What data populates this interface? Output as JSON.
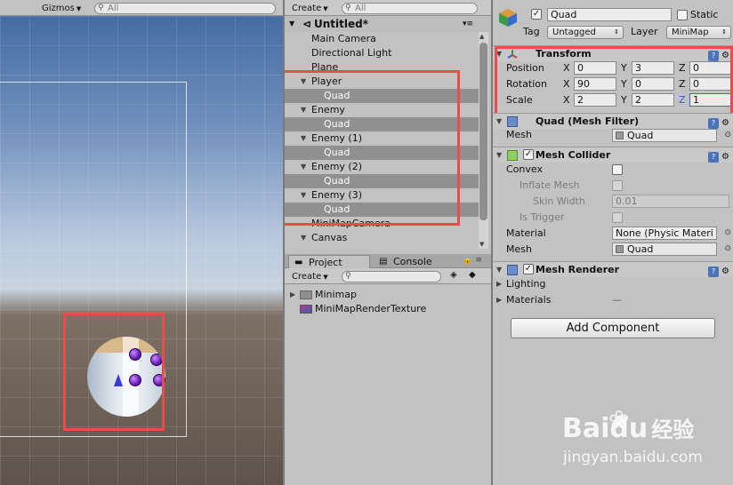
{
  "scene": {
    "gizmos_label": "Gizmos",
    "search_placeholder": "All"
  },
  "hierarchy": {
    "create_label": "Create",
    "search_placeholder": "All",
    "scene_title": "Untitled*",
    "items": [
      {
        "label": "Main Camera"
      },
      {
        "label": "Directional Light"
      },
      {
        "label": "Plane"
      },
      {
        "label": "Player"
      },
      {
        "label": "Quad"
      },
      {
        "label": "Enemy"
      },
      {
        "label": "Quad"
      },
      {
        "label": "Enemy (1)"
      },
      {
        "label": "Quad"
      },
      {
        "label": "Enemy (2)"
      },
      {
        "label": "Quad"
      },
      {
        "label": "Enemy (3)"
      },
      {
        "label": "Quad"
      },
      {
        "label": "MiniMapCamera"
      },
      {
        "label": "Canvas"
      }
    ]
  },
  "project": {
    "tab_project": "Project",
    "tab_console": "Console",
    "create_label": "Create",
    "items": [
      {
        "label": "Minimap",
        "icon": "folder-icon"
      },
      {
        "label": "MiniMapRenderTexture",
        "icon": "render-texture-icon"
      }
    ]
  },
  "inspector": {
    "object_name": "Quad",
    "static_label": "Static",
    "tag_label": "Tag",
    "tag_value": "Untagged",
    "layer_label": "Layer",
    "layer_value": "MiniMap",
    "transform": {
      "title": "Transform",
      "position_label": "Position",
      "rotation_label": "Rotation",
      "scale_label": "Scale",
      "x_label": "X",
      "y_label": "Y",
      "z_label": "Z",
      "position": {
        "x": "0",
        "y": "3",
        "z": "0"
      },
      "rotation": {
        "x": "90",
        "y": "0",
        "z": "0"
      },
      "scale": {
        "x": "2",
        "y": "2",
        "z": "1"
      }
    },
    "mesh_filter": {
      "title": "Quad (Mesh Filter)",
      "mesh_label": "Mesh",
      "mesh_value": "Quad"
    },
    "mesh_collider": {
      "title": "Mesh Collider",
      "convex_label": "Convex",
      "inflate_label": "Inflate Mesh",
      "skin_label": "Skin Width",
      "skin_value": "0.01",
      "trigger_label": "Is Trigger",
      "material_label": "Material",
      "material_value": "None (Physic Materi",
      "mesh_label": "Mesh",
      "mesh_value": "Quad"
    },
    "mesh_renderer": {
      "title": "Mesh Renderer",
      "lighting_label": "Lighting",
      "materials_label": "Materials",
      "materials_value": "—"
    },
    "add_component_label": "Add Component"
  },
  "watermark": {
    "brand": "Baidu",
    "brand_cn": "经验",
    "url": "jingyan.baidu.com"
  },
  "colors": {
    "highlight_red": "#e84c4c",
    "selection_gray": "#909090",
    "help_blue": "#4b73b8"
  }
}
